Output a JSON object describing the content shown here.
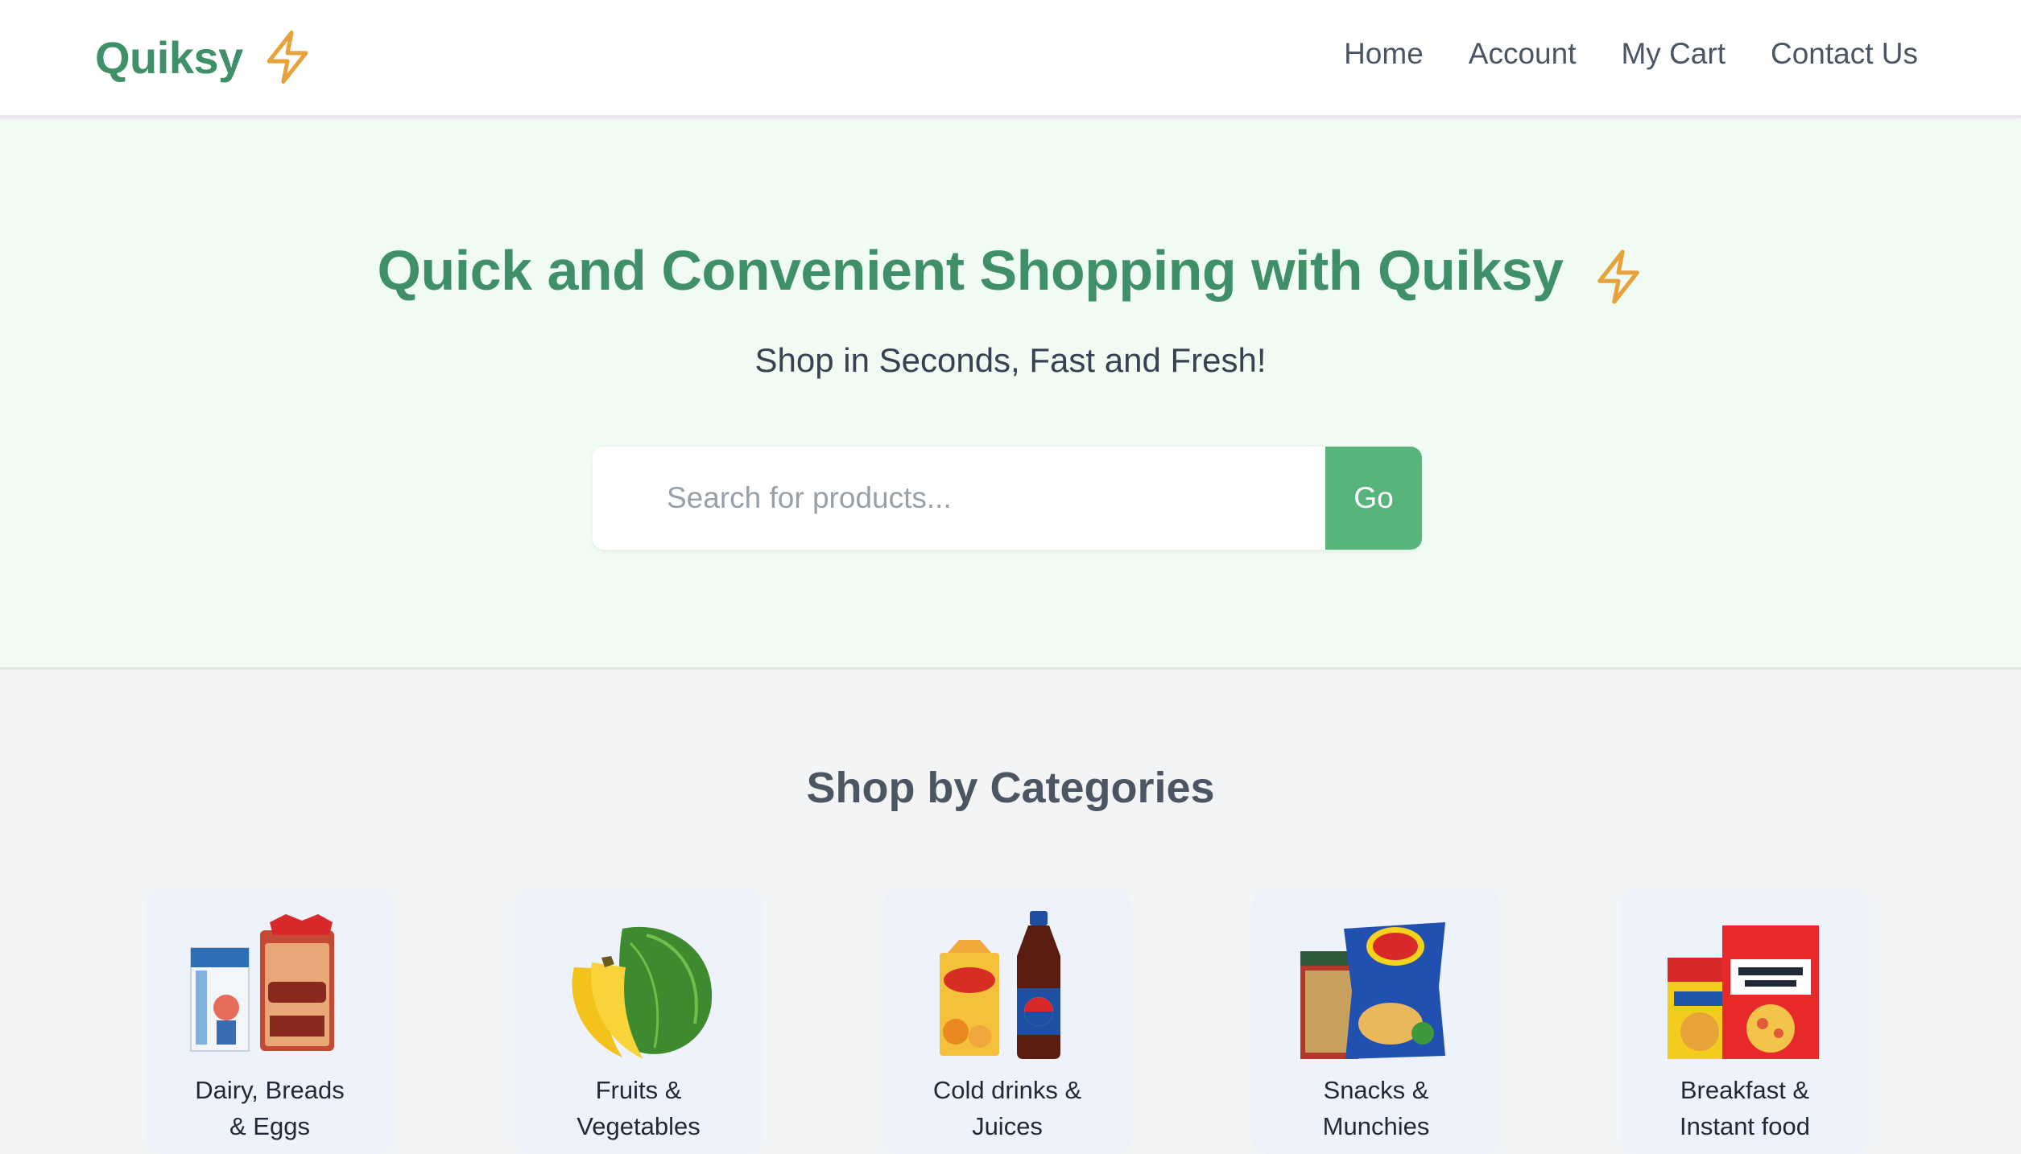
{
  "header": {
    "logo_text": "Quiksy",
    "nav": [
      {
        "label": "Home"
      },
      {
        "label": "Account"
      },
      {
        "label": "My Cart"
      },
      {
        "label": "Contact Us"
      }
    ]
  },
  "hero": {
    "title": "Quick and Convenient Shopping with Quiksy",
    "subtitle": "Shop in Seconds, Fast and Fresh!",
    "search": {
      "placeholder": "Search for products...",
      "value": "",
      "button_label": "Go"
    }
  },
  "categories": {
    "title": "Shop by Categories",
    "items": [
      {
        "line1": "Dairy, Breads",
        "line2": "& Eggs",
        "image": "dairy-bread-eggs-image"
      },
      {
        "line1": "Fruits &",
        "line2": "Vegetables",
        "image": "fruits-vegetables-image"
      },
      {
        "line1": "Cold drinks &",
        "line2": "Juices",
        "image": "cold-drinks-juices-image"
      },
      {
        "line1": "Snacks &",
        "line2": "Munchies",
        "image": "snacks-munchies-image"
      },
      {
        "line1": "Breakfast &",
        "line2": "Instant food",
        "image": "breakfast-instant-food-image"
      }
    ]
  },
  "colors": {
    "brand_green": "#3f9068",
    "button_green": "#57b47c",
    "bolt_orange": "#e7a23c",
    "hero_bg": "#effbf3",
    "page_bg": "#f3f4f6"
  }
}
